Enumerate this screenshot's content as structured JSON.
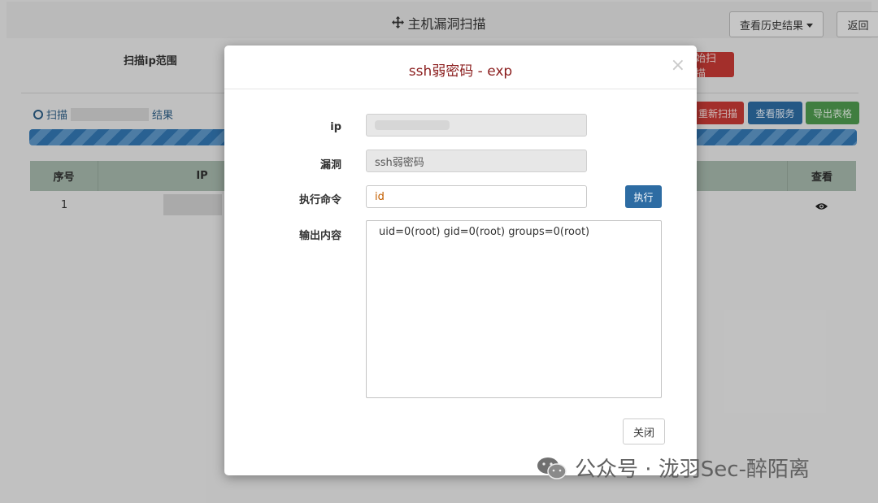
{
  "header": {
    "title": "主机漏洞扫描",
    "history_label": "查看历史结果",
    "back_label": "返回"
  },
  "scan_form": {
    "range_label": "扫描ip范围",
    "start_button_partial": "始扫描"
  },
  "scan_results": {
    "prefix": "扫描",
    "suffix": "结果",
    "rescan_label": "重新扫描",
    "services_label": "查看服务",
    "export_label": "导出表格",
    "progress_percent": 100
  },
  "table": {
    "columns": [
      "序号",
      "IP",
      "查看"
    ],
    "rows": [
      {
        "num": "1"
      }
    ]
  },
  "modal": {
    "title": "ssh弱密码 - exp",
    "close_glyph": "×",
    "ip_label": "ip",
    "vuln_label": "漏洞",
    "vuln_value": "ssh弱密码",
    "cmd_label": "执行命令",
    "cmd_value": "id",
    "exec_label": "执行",
    "output_label": "输出内容",
    "output_value": "uid=0(root) gid=0(root) groups=0(root)",
    "close_label": "关闭"
  },
  "watermark": {
    "text": "公众号 · 泷羽Sec-醉陌离"
  },
  "colors": {
    "danger": "#c73a35",
    "primary": "#2d6ca3",
    "success": "#4f9a4f",
    "modal_title": "#8b1e1e"
  },
  "icons": [
    "move-icon",
    "caret-down-icon",
    "clock-icon",
    "eye-icon",
    "close-icon",
    "wechat-icon"
  ]
}
